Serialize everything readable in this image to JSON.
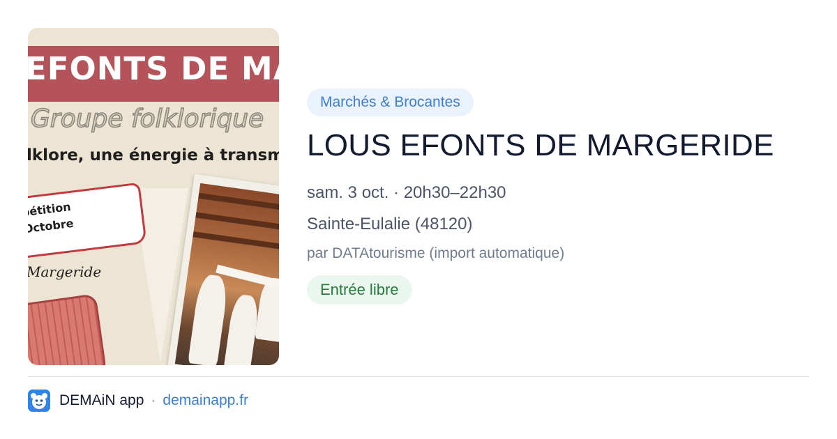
{
  "poster": {
    "banner_text": "EFONTS DE MAR",
    "subtitle": "Groupe folklorique",
    "tagline": "lklore, une énergie à transm",
    "ribbon_line_1": "pétition",
    "ribbon_line_2": "Octobre",
    "signature": "Margeride"
  },
  "event": {
    "category": "Marchés & Brocantes",
    "title": "LOUS EFONTS DE MARGERIDE",
    "datetime": "sam. 3 oct. · 20h30–22h30",
    "location": "Sainte-Eulalie (48120)",
    "source": "par DATAtourisme (import automatique)",
    "price": "Entrée libre"
  },
  "footer": {
    "app_name": "DEMAiN app",
    "separator": "·",
    "link": "demainapp.fr",
    "logo_icon": "demain-app-logo-icon"
  },
  "colors": {
    "category_badge_bg": "#eaf2fd",
    "category_badge_text": "#3b7fd8",
    "price_badge_bg": "#eaf7ee",
    "price_badge_text": "#2b7a41",
    "link": "#3b7fd8",
    "logo": "#2f86e8"
  }
}
